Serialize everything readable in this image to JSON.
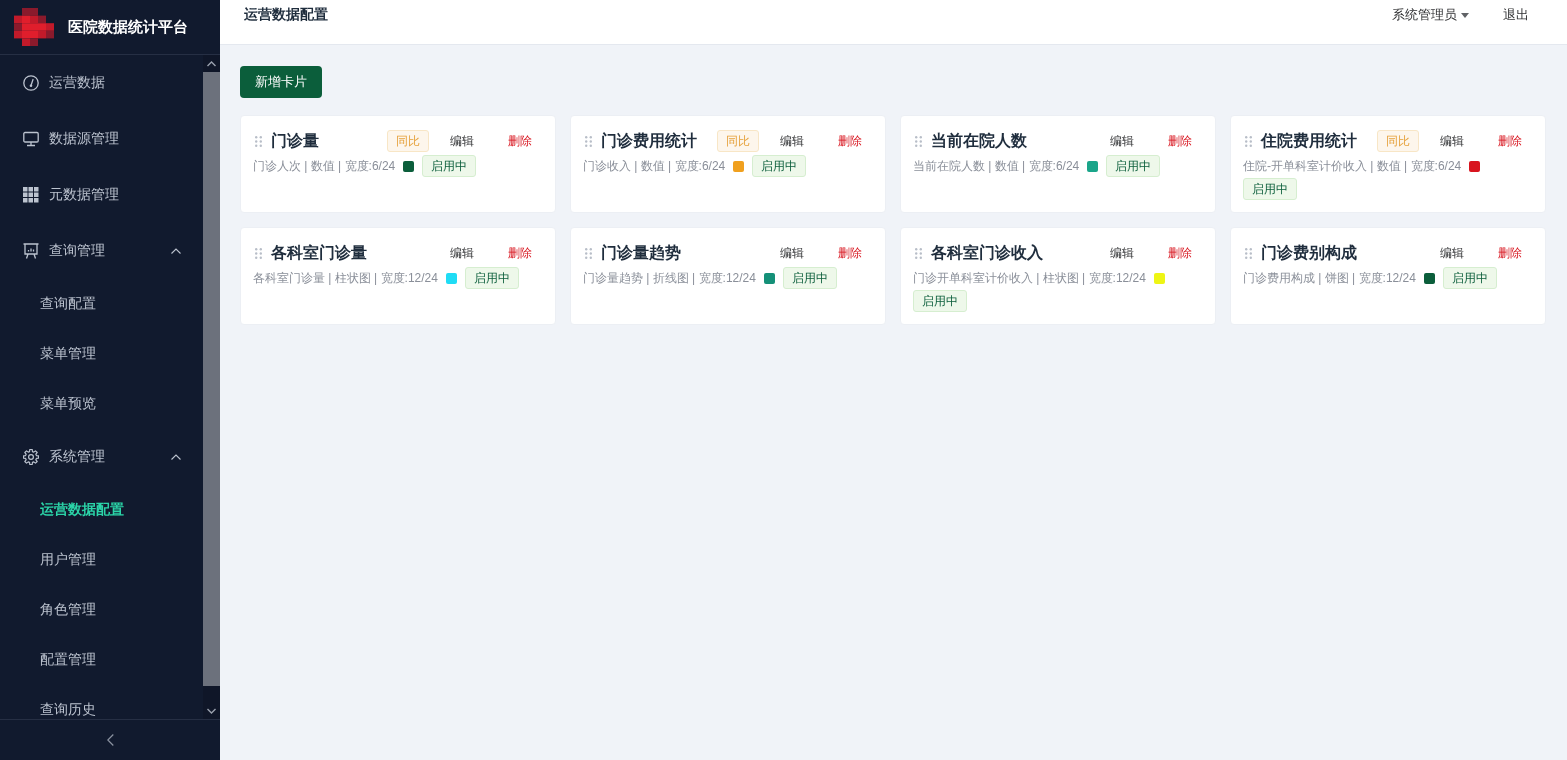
{
  "sidebar": {
    "title": "医院数据统计平台",
    "menu": [
      {
        "label": "运营数据",
        "selected": false
      },
      {
        "label": "数据源管理",
        "selected": false
      },
      {
        "label": "元数据管理",
        "selected": false
      },
      {
        "label": "查询管理",
        "selected": false,
        "expanded": true,
        "children": [
          {
            "label": "查询配置",
            "selected": false
          },
          {
            "label": "菜单管理",
            "selected": false
          },
          {
            "label": "菜单预览",
            "selected": false
          }
        ]
      },
      {
        "label": "系统管理",
        "selected": false,
        "expanded": true,
        "children": [
          {
            "label": "运营数据配置",
            "selected": true
          },
          {
            "label": "用户管理",
            "selected": false
          },
          {
            "label": "角色管理",
            "selected": false
          },
          {
            "label": "配置管理",
            "selected": false
          },
          {
            "label": "查询历史",
            "selected": false
          }
        ]
      }
    ]
  },
  "header": {
    "title": "运营数据配置",
    "user": "系统管理员",
    "logout": "退出"
  },
  "toolbar": {
    "add_button": "新增卡片"
  },
  "cards": [
    {
      "title": "门诊量",
      "badge": "同比",
      "edit": "编辑",
      "delete": "删除",
      "meta": "门诊人次 | 数值 | 宽度:6/24",
      "color": "#0b5e3b",
      "status": "启用中"
    },
    {
      "title": "门诊费用统计",
      "badge": "同比",
      "edit": "编辑",
      "delete": "删除",
      "meta": "门诊收入 | 数值 | 宽度:6/24",
      "color": "#f0a01e",
      "status": "启用中"
    },
    {
      "title": "当前在院人数",
      "edit": "编辑",
      "delete": "删除",
      "meta": "当前在院人数 | 数值 | 宽度:6/24",
      "color": "#1aa58a",
      "status": "启用中"
    },
    {
      "title": "住院费用统计",
      "badge": "同比",
      "edit": "编辑",
      "delete": "删除",
      "meta": "住院-开单科室计价收入 | 数值 | 宽度:6/24",
      "color": "#d8141e",
      "status": "启用中"
    },
    {
      "title": "各科室门诊量",
      "edit": "编辑",
      "delete": "删除",
      "meta": "各科室门诊量 | 柱状图 | 宽度:12/24",
      "color": "#1fdcf5",
      "status": "启用中"
    },
    {
      "title": "门诊量趋势",
      "edit": "编辑",
      "delete": "删除",
      "meta": "门诊量趋势 | 折线图 | 宽度:12/24",
      "color": "#149078",
      "status": "启用中"
    },
    {
      "title": "各科室门诊收入",
      "edit": "编辑",
      "delete": "删除",
      "meta": "门诊开单科室计价收入 | 柱状图 | 宽度:12/24",
      "color": "#eef514",
      "status": "启用中"
    },
    {
      "title": "门诊费别构成",
      "edit": "编辑",
      "delete": "删除",
      "meta": "门诊费用构成 | 饼图 | 宽度:12/24",
      "color": "#0b5e3b",
      "status": "启用中"
    }
  ]
}
